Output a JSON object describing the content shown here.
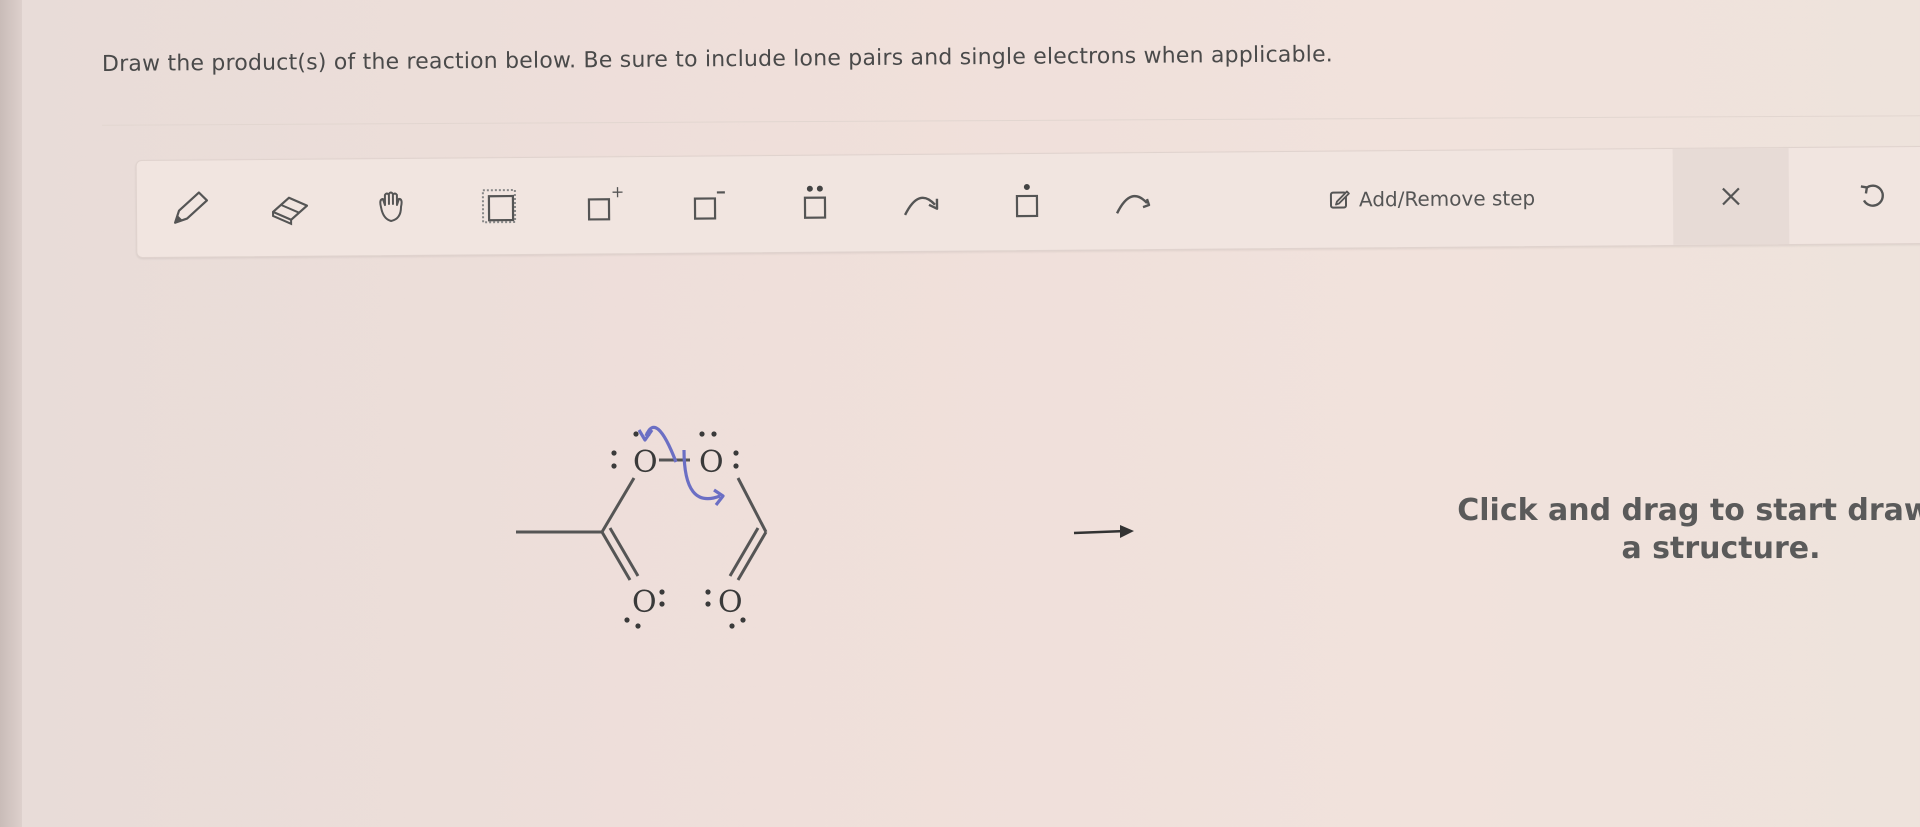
{
  "question": {
    "text": "Draw the product(s) of the reaction below. Be sure to include lone pairs and single electrons when applicable."
  },
  "toolbar": {
    "tools": [
      {
        "id": "pencil",
        "icon": "pencil-icon"
      },
      {
        "id": "eraser",
        "icon": "eraser-icon"
      },
      {
        "id": "hand",
        "icon": "hand-icon"
      },
      {
        "id": "select",
        "icon": "selection-box-icon"
      },
      {
        "id": "positive-charge",
        "icon": "positive-charge-icon",
        "symbol": "+"
      },
      {
        "id": "negative-charge",
        "icon": "negative-charge-icon",
        "symbol": "−"
      },
      {
        "id": "lone-pair",
        "icon": "lone-pair-icon"
      },
      {
        "id": "double-arrow",
        "icon": "curved-arrow-pair-icon"
      },
      {
        "id": "single-electron",
        "icon": "single-electron-icon"
      },
      {
        "id": "single-arrow",
        "icon": "curved-arrow-single-icon"
      }
    ],
    "add_remove_step_label": "Add/Remove step",
    "clear_icon": "close-icon",
    "undo_icon": "undo-icon"
  },
  "reaction": {
    "atoms": {
      "o_top_left": "O",
      "o_top_right": "O",
      "o_bottom_left": "O",
      "o_bottom_right": "O"
    },
    "arrow_color": "#6b6fc4"
  },
  "canvas": {
    "hint": "Click and drag to start drawing a structure."
  }
}
